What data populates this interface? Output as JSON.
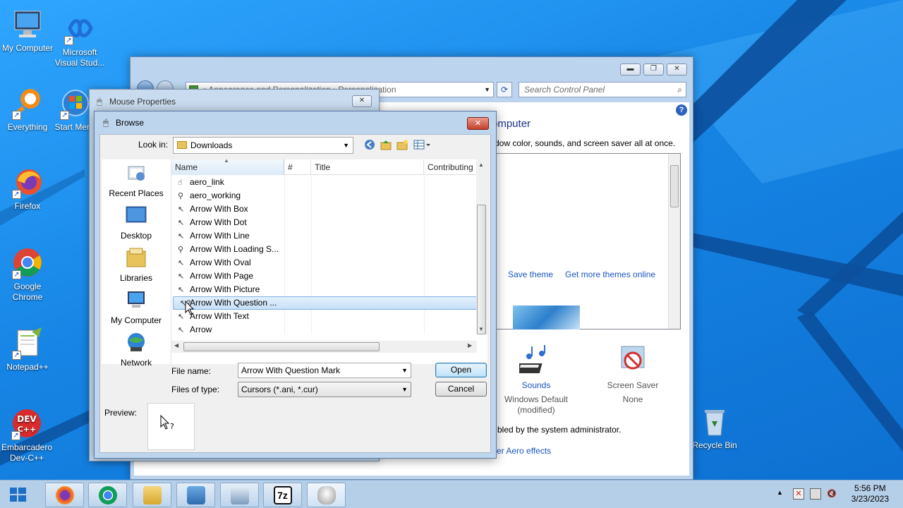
{
  "desktop": {
    "icons": [
      {
        "label": "My Computer",
        "icon": "my-computer-icon"
      },
      {
        "label": "Microsoft Visual Stud...",
        "icon": "visual-studio-icon"
      },
      {
        "label": "Everything",
        "icon": "everything-search-icon"
      },
      {
        "label": "Start Menu",
        "icon": "start-menu-icon"
      },
      {
        "label": "Firefox",
        "icon": "firefox-icon"
      },
      {
        "label": "Google Chrome",
        "icon": "chrome-icon"
      },
      {
        "label": "Notepad++",
        "icon": "notepadpp-icon"
      },
      {
        "label": "Embarcadero Dev-C++",
        "icon": "devcpp-icon"
      },
      {
        "label": "Recycle Bin",
        "icon": "recycle-bin-icon"
      }
    ]
  },
  "control_panel": {
    "breadcrumb": "« Appearance and Personalization › Personalization",
    "search_placeholder": "Search Control Panel",
    "heading": "omputer",
    "subtitle": "dow color, sounds, and screen saver all at once.",
    "save_theme": "Save theme",
    "more_themes": "Get more themes online",
    "sounds_label": "Sounds",
    "sounds_value": "Windows Default (modified)",
    "screensaver_label": "Screen Saver",
    "screensaver_value": "None",
    "admin_note": "bled by the system administrator.",
    "aero_link": "er Aero effects"
  },
  "mouse_properties": {
    "title": "Mouse Properties"
  },
  "browse": {
    "title": "Browse",
    "look_in_label": "Look in:",
    "look_in_value": "Downloads",
    "places": [
      {
        "label": "Recent Places",
        "icon": "recent-places-icon"
      },
      {
        "label": "Desktop",
        "icon": "desktop-icon"
      },
      {
        "label": "Libraries",
        "icon": "libraries-icon"
      },
      {
        "label": "My Computer",
        "icon": "my-computer-icon"
      },
      {
        "label": "Network",
        "icon": "network-icon"
      }
    ],
    "columns": {
      "name": "Name",
      "num": "#",
      "title": "Title",
      "contrib": "Contributing"
    },
    "files": [
      {
        "name": "aero_link",
        "icon": "hand-cursor-icon"
      },
      {
        "name": "aero_working",
        "icon": "busy-cursor-icon"
      },
      {
        "name": "Arrow With Box",
        "icon": "arrow-cursor-icon"
      },
      {
        "name": "Arrow With Dot",
        "icon": "arrow-cursor-icon"
      },
      {
        "name": "Arrow With Line",
        "icon": "arrow-cursor-icon"
      },
      {
        "name": "Arrow With Loading S...",
        "icon": "busy-cursor-icon"
      },
      {
        "name": "Arrow With Oval",
        "icon": "arrow-cursor-icon"
      },
      {
        "name": "Arrow With Page",
        "icon": "arrow-cursor-icon"
      },
      {
        "name": "Arrow With Picture",
        "icon": "arrow-cursor-icon"
      },
      {
        "name": "Arrow With Question ...",
        "icon": "help-cursor-icon",
        "selected": true
      },
      {
        "name": "Arrow With Text",
        "icon": "arrow-cursor-icon"
      },
      {
        "name": "Arrow",
        "icon": "arrow-cursor-icon"
      }
    ],
    "file_name_label": "File name:",
    "file_name_value": "Arrow With Question Mark",
    "files_of_type_label": "Files of type:",
    "files_of_type_value": "Cursors (*.ani, *.cur)",
    "open_label": "Open",
    "cancel_label": "Cancel",
    "preview_label": "Preview:"
  },
  "taskbar": {
    "apps": [
      "firefox-icon",
      "chrome-icon",
      "file-explorer-icon",
      "control-panel-icon",
      "keyboard-icon",
      "7zip-icon",
      "mouse-icon"
    ],
    "time": "5:56 PM",
    "date": "3/23/2023"
  }
}
